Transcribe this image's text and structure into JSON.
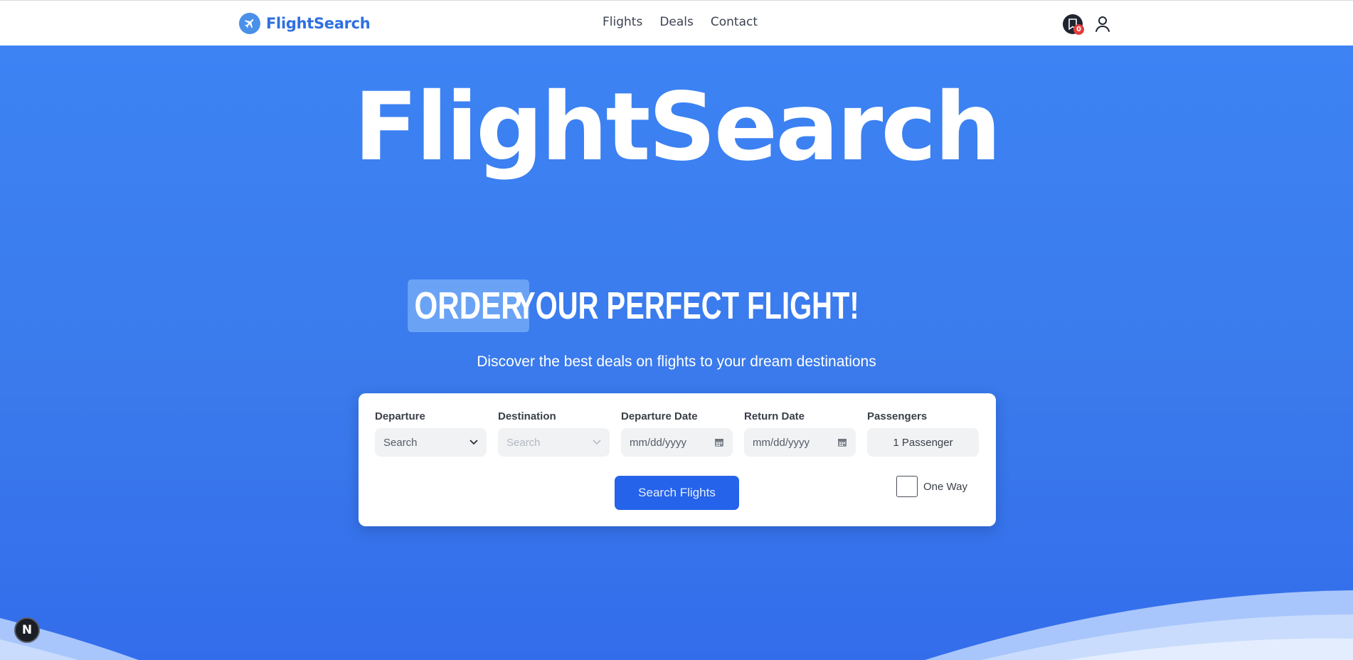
{
  "header": {
    "brand": "FlightSearch",
    "nav": [
      "Flights",
      "Deals",
      "Contact"
    ],
    "bookmark_count": "0"
  },
  "hero": {
    "title": "FlightSearch",
    "headline_highlight": "ORDER",
    "headline_rest": "YOUR PERFECT FLIGHT!",
    "subtitle": "Discover the best deals on flights to your dream destinations"
  },
  "search": {
    "departure_label": "Departure",
    "departure_placeholder": "Search",
    "destination_label": "Destination",
    "destination_placeholder": "Search",
    "departure_date_label": "Departure Date",
    "departure_date_placeholder": "mm/dd/yyyy",
    "return_date_label": "Return Date",
    "return_date_placeholder": "mm/dd/yyyy",
    "passengers_label": "Passengers",
    "passengers_value": "1 Passenger",
    "submit_label": "Search Flights",
    "one_way_label": "One Way"
  },
  "dev_badge": "N",
  "colors": {
    "accent": "#2563eb",
    "brand": "#2f6fe0",
    "hero_bg": "#3b7fef",
    "badge": "#e23b3b"
  },
  "icons": [
    "plane-icon",
    "bookmark-icon",
    "user-icon",
    "chevron-down-icon",
    "calendar-icon"
  ]
}
